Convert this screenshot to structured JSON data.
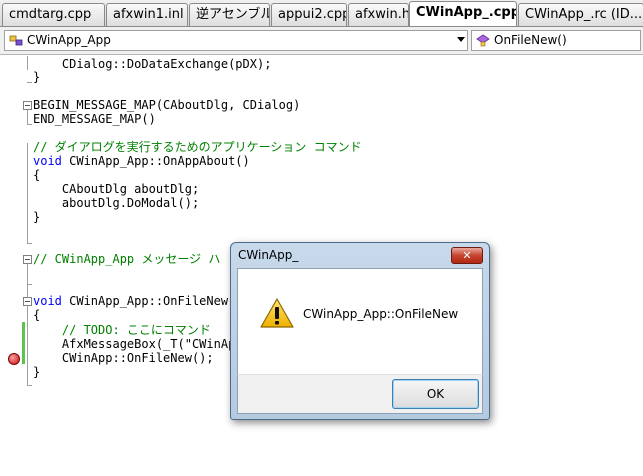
{
  "tabs": [
    {
      "label": "cmdtarg.cpp",
      "active": false
    },
    {
      "label": "afxwin1.inl",
      "active": false
    },
    {
      "label": "逆アセンブル",
      "active": false
    },
    {
      "label": "appui2.cpp",
      "active": false
    },
    {
      "label": "afxwin.h",
      "active": false
    },
    {
      "label": "CWinApp_.cpp",
      "active": true
    },
    {
      "label": "CWinApp_.rc (ID...",
      "active": false
    }
  ],
  "navbar": {
    "class_combo": "CWinApp_App",
    "member_combo": "OnFileNew()"
  },
  "code": {
    "line1": "    CDialog::DoDataExchange(pDX);",
    "line2": "}",
    "line3": "BEGIN_MESSAGE_MAP(CAboutDlg, CDialog)",
    "line4": "END_MESSAGE_MAP()",
    "line5": "// ダイアログを実行するためのアプリケーション コマンド",
    "line6_kw": "void",
    "line6_rest": " CWinApp_App::OnAppAbout()",
    "line7": "{",
    "line8": "    CAboutDlg aboutDlg;",
    "line9": "    aboutDlg.DoModal();",
    "line10": "}",
    "line11": "// CWinApp_App メッセージ ハ",
    "line12_kw": "void",
    "line12_rest": " CWinApp_App::OnFileNew()",
    "line13": "{",
    "line14": "    // TODO: ここにコマンド",
    "line15": "    AfxMessageBox(_T(\"CWinAp",
    "line16": "    CWinApp::OnFileNew();",
    "line17": "}"
  },
  "dialog": {
    "title": "CWinApp_",
    "close_label": "✕",
    "message": "CWinApp_App::OnFileNew",
    "ok_label": "OK"
  },
  "icons": {
    "class_combo_icon": "class-icon",
    "member_combo_icon": "method-icon",
    "dialog_icon": "warning-icon",
    "breakpoint_icon": "breakpoint-icon"
  },
  "colors": {
    "keyword": "#0000ff",
    "comment": "#008000",
    "change_bar": "#5ec24d",
    "close_button": "#c7432f",
    "breakpoint": "#c21010"
  }
}
